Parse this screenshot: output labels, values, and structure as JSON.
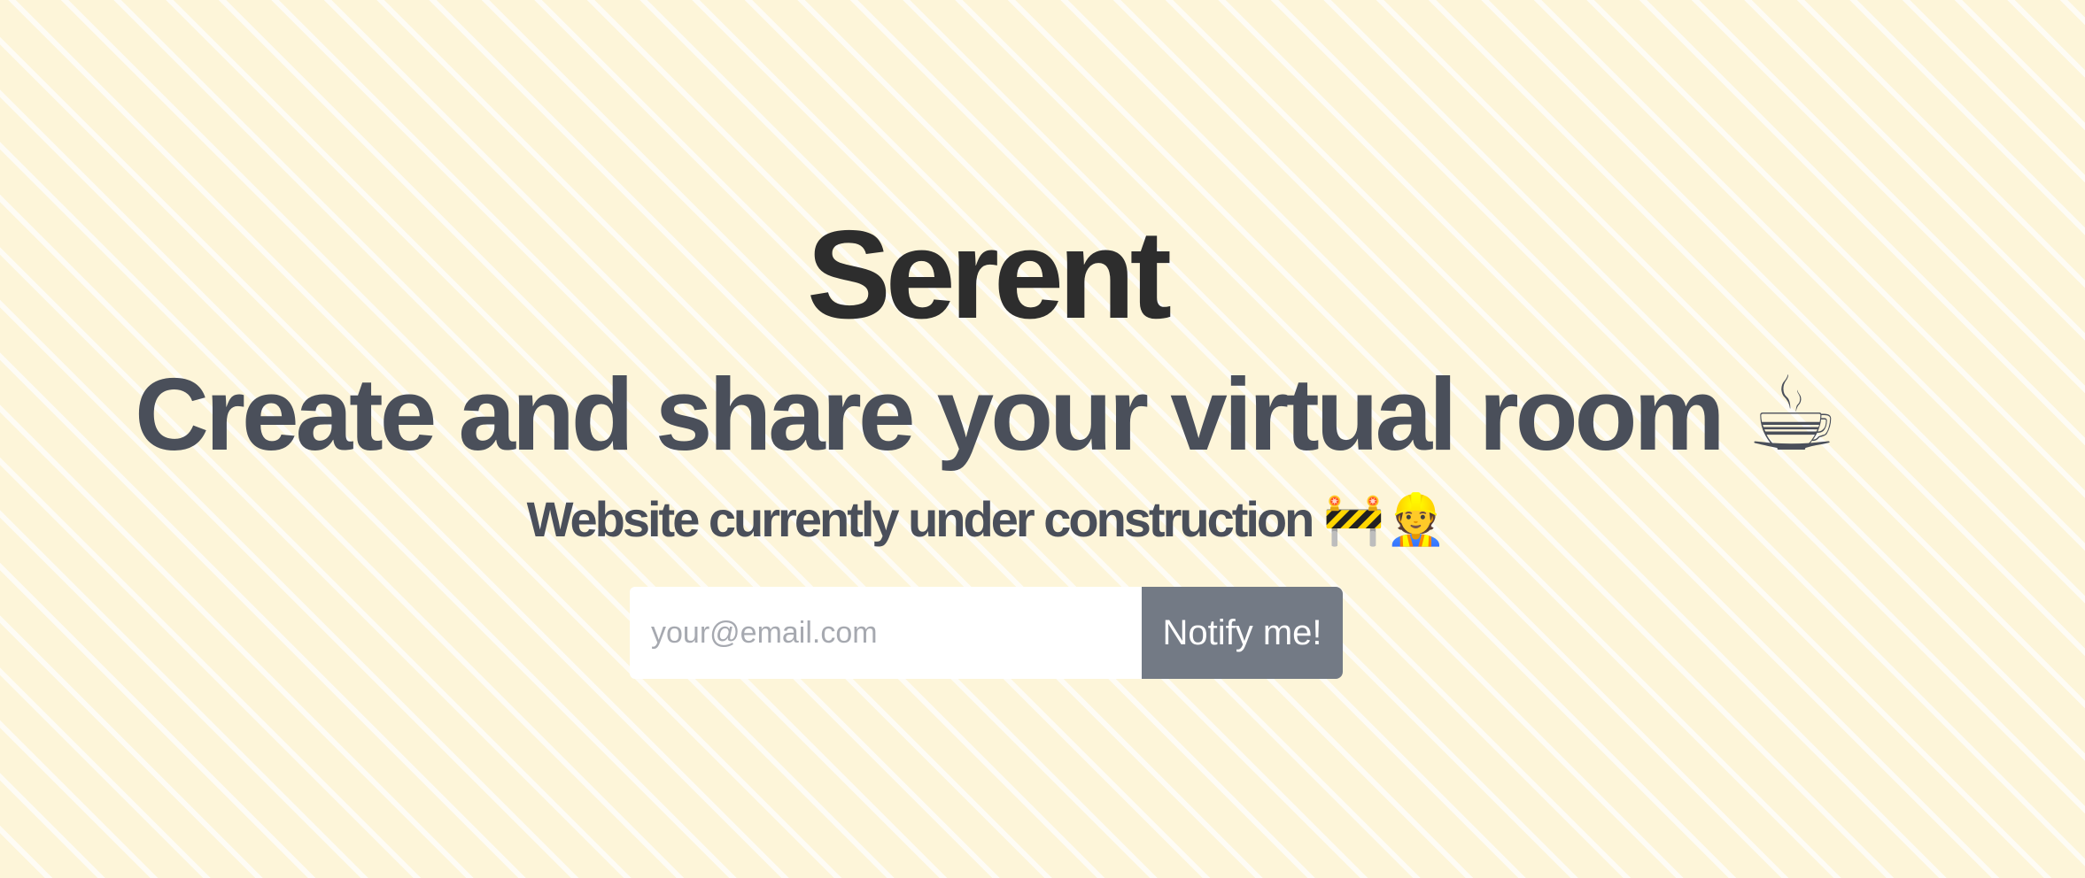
{
  "brand": {
    "name": "Serent"
  },
  "hero": {
    "tagline": "Create and share your virtual room",
    "tagline_emoji": "☕",
    "subline": "Website currently under construction",
    "subline_emoji": "🚧👷"
  },
  "signup": {
    "email_placeholder": "your@email.com",
    "email_value": "",
    "button_label": "Notify me!"
  },
  "colors": {
    "background": "#fdf5d9",
    "stripe": "#ffffff",
    "brand_text": "#2d2d2d",
    "heading_text": "#4a4f5a",
    "button_bg": "#737a85",
    "button_text": "#ffffff"
  }
}
